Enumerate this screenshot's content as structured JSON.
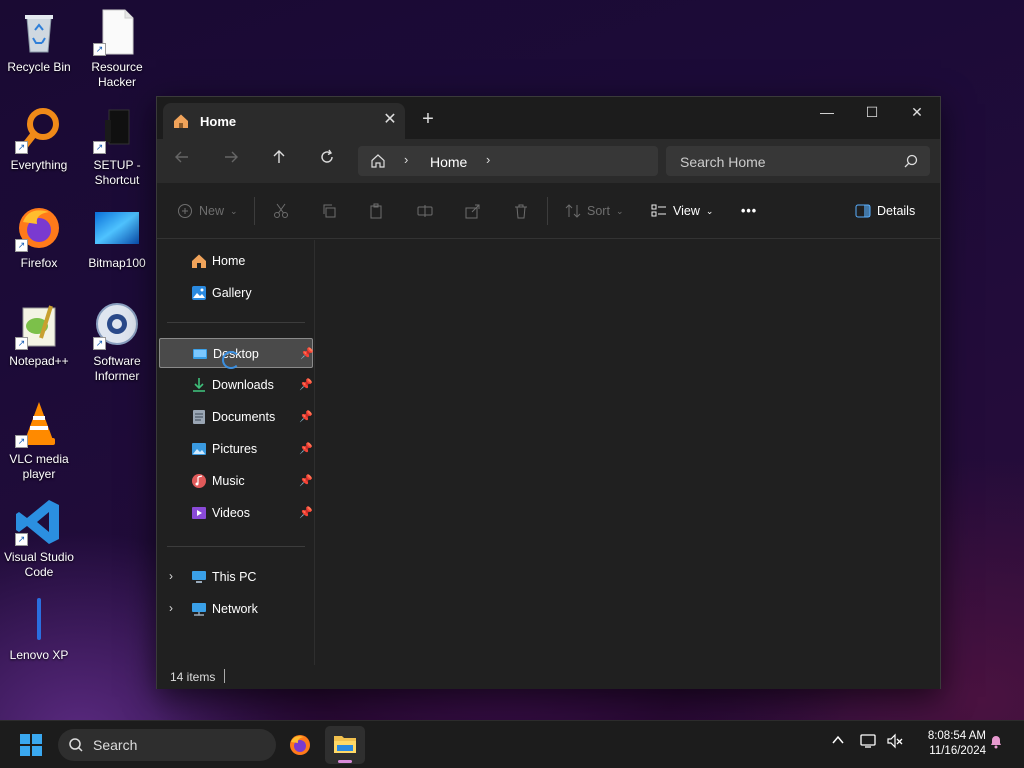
{
  "desktop": {
    "icons": [
      {
        "label": "Recycle Bin",
        "icon": "recycle-bin-icon",
        "shortcut": false
      },
      {
        "label": "Resource Hacker",
        "icon": "document-icon",
        "shortcut": true
      },
      {
        "label": "Everything",
        "icon": "magnifier-icon",
        "shortcut": true
      },
      {
        "label": "SETUP - Shortcut",
        "icon": "setup-icon",
        "shortcut": true
      },
      {
        "label": "Firefox",
        "icon": "firefox-icon",
        "shortcut": true
      },
      {
        "label": "Bitmap100",
        "icon": "bitmap-icon",
        "shortcut": false
      },
      {
        "label": "Notepad++",
        "icon": "notepadpp-icon",
        "shortcut": true
      },
      {
        "label": "Software Informer",
        "icon": "software-informer-icon",
        "shortcut": true
      },
      {
        "label": "VLC media player",
        "icon": "vlc-icon",
        "shortcut": true
      },
      {
        "label": "Visual Studio Code",
        "icon": "vscode-icon",
        "shortcut": true
      },
      {
        "label": "Lenovo XP",
        "icon": "lenovo-xp-icon",
        "shortcut": false
      }
    ]
  },
  "explorer": {
    "tab": {
      "label": "Home",
      "close": "✕"
    },
    "new_tab": "+",
    "window_controls": {
      "minimize": "—",
      "maximize": "☐",
      "close": "✕"
    },
    "address": {
      "crumb": "Home"
    },
    "search": {
      "placeholder": "Search Home"
    },
    "commands": {
      "new": "New",
      "sort": "Sort",
      "view": "View",
      "more": "•••",
      "details": "Details"
    },
    "nav": {
      "home": "Home",
      "gallery": "Gallery",
      "quick_access": [
        {
          "label": "Desktop",
          "pinned": true,
          "selected": true
        },
        {
          "label": "Downloads",
          "pinned": true
        },
        {
          "label": "Documents",
          "pinned": true
        },
        {
          "label": "Pictures",
          "pinned": true
        },
        {
          "label": "Music",
          "pinned": true
        },
        {
          "label": "Videos",
          "pinned": true
        }
      ],
      "this_pc": "This PC",
      "network": "Network"
    },
    "status": {
      "item_count": "14 items"
    }
  },
  "taskbar": {
    "search_label": "Search",
    "apps": [
      "firefox-icon",
      "file-explorer-icon"
    ],
    "active_app": "file-explorer-icon",
    "clock": {
      "time": "8:08:54 AM",
      "date": "11/16/2024"
    }
  },
  "colors": {
    "window_bg": "#202020",
    "toolbar_bg": "#2b2b2b",
    "accent": "#3b8fe0",
    "selection": "#4a4a4a"
  }
}
